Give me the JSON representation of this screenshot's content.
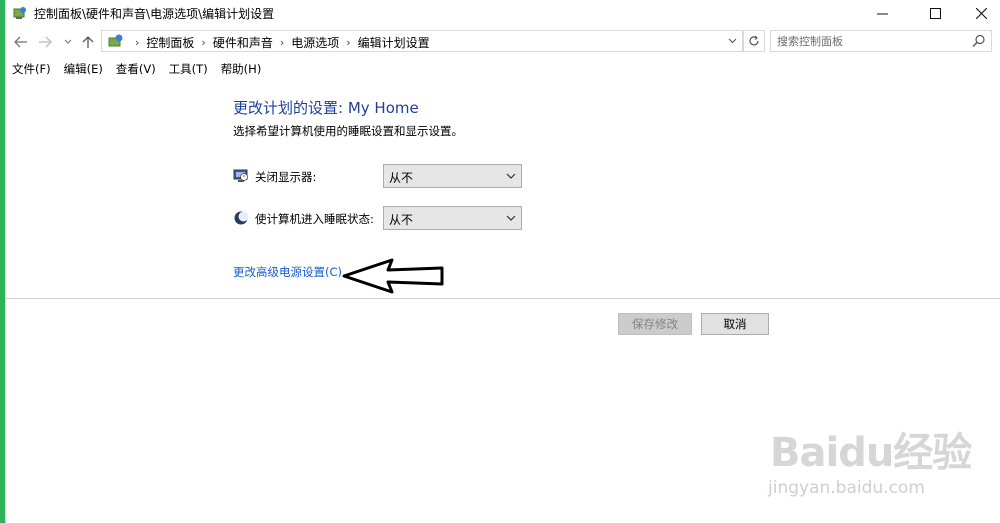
{
  "window": {
    "title": "控制面板\\硬件和声音\\电源选项\\编辑计划设置",
    "minimize_icon": "minimize-icon",
    "maximize_icon": "maximize-icon",
    "close_icon": "close-icon"
  },
  "navigation": {
    "back_icon": "arrow-left-icon",
    "forward_icon": "arrow-right-icon",
    "recent_icon": "chevron-down-icon",
    "up_icon": "arrow-up-icon",
    "breadcrumb": [
      "控制面板",
      "硬件和声音",
      "电源选项",
      "编辑计划设置"
    ],
    "search_placeholder": "搜索控制面板"
  },
  "menu": [
    "文件(F)",
    "编辑(E)",
    "查看(V)",
    "工具(T)",
    "帮助(H)"
  ],
  "content": {
    "title": "更改计划的设置: My Home",
    "subtitle": "选择希望计算机使用的睡眠设置和显示设置。",
    "settings": [
      {
        "label": "关闭显示器:",
        "value": "从不",
        "icon": "monitor-icon"
      },
      {
        "label": "使计算机进入睡眠状态:",
        "value": "从不",
        "icon": "moon-icon"
      }
    ],
    "advanced_link": "更改高级电源设置(C)"
  },
  "buttons": {
    "save": "保存修改",
    "cancel": "取消"
  },
  "watermark": {
    "logo_text": "Baidu经验",
    "url": "jingyan.baidu.com"
  },
  "colors": {
    "title_blue": "#1e3f9c",
    "link_blue": "#1a5bd1",
    "left_strip_green": "#2fb35a"
  }
}
